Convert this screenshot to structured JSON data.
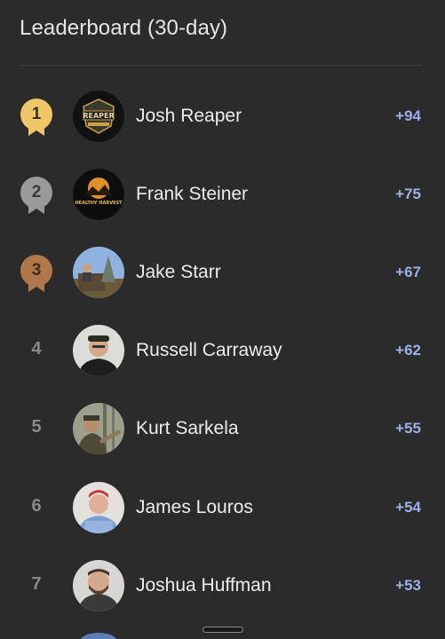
{
  "header": {
    "title": "Leaderboard (30-day)"
  },
  "colors": {
    "background": "#2b2b2b",
    "gold": "#f0c768",
    "silver": "#9a9a9a",
    "bronze": "#b0784a",
    "score": "#9cb0e8"
  },
  "leaders": [
    {
      "rank": "1",
      "name": "Josh Reaper",
      "score": "+94",
      "medal": "gold",
      "avatar": "reaper-logo-avatar",
      "logo_text": "REAPER"
    },
    {
      "rank": "2",
      "name": "Frank Steiner",
      "score": "+75",
      "medal": "silver",
      "avatar": "healthy-harvest-logo-avatar",
      "logo_text": "HEALTHY HARVEST"
    },
    {
      "rank": "3",
      "name": "Jake Starr",
      "score": "+67",
      "medal": "bronze",
      "avatar": "outdoor-photo-avatar"
    },
    {
      "rank": "4",
      "name": "Russell Carraway",
      "score": "+62",
      "medal": "none",
      "avatar": "person-photo-avatar"
    },
    {
      "rank": "5",
      "name": "Kurt Sarkela",
      "score": "+55",
      "medal": "none",
      "avatar": "hunter-photo-avatar"
    },
    {
      "rank": "6",
      "name": "James Louros",
      "score": "+54",
      "medal": "none",
      "avatar": "person-photo-avatar"
    },
    {
      "rank": "7",
      "name": "Joshua Huffman",
      "score": "+53",
      "medal": "none",
      "avatar": "person-photo-avatar"
    }
  ]
}
